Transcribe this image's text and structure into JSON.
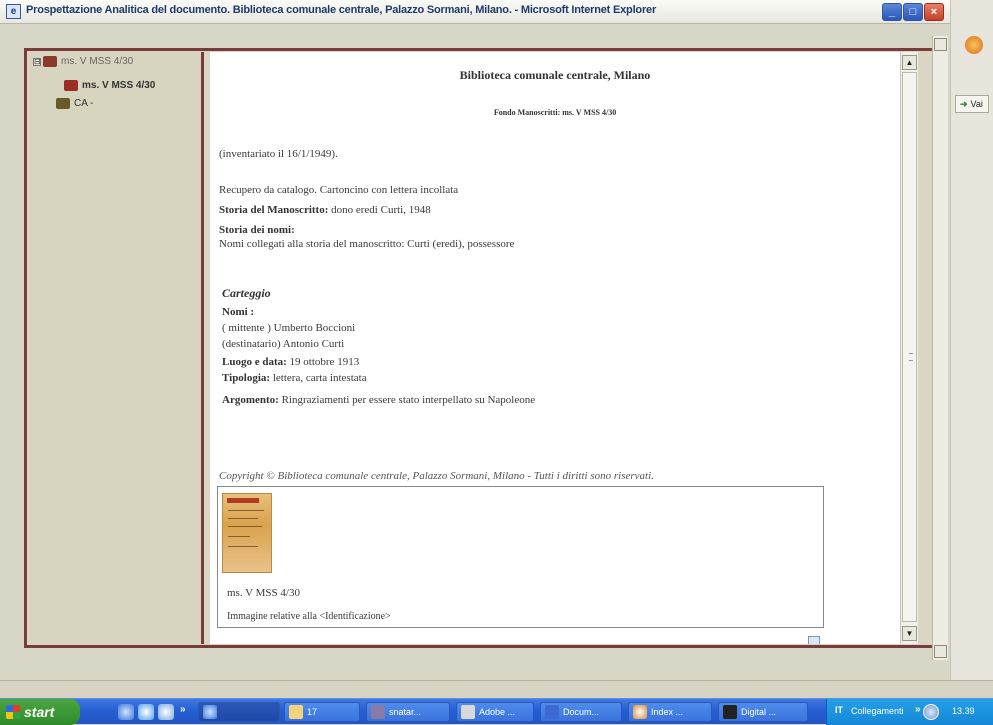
{
  "window": {
    "title": "Prospettazione Analitica del documento. Biblioteca comunale centrale, Palazzo Sormani, Milano. - Microsoft Internet Explorer",
    "min_label": "_",
    "max_label": "□",
    "close_label": "×"
  },
  "right_strip": {
    "vai_label": "Vai"
  },
  "tree": {
    "root_expander": "⊟",
    "root_label": "ms. V MSS 4/30",
    "child1_label": "ms. V MSS 4/30",
    "child2_label": "CA -"
  },
  "content": {
    "heading": "Biblioteca comunale centrale, Milano",
    "fondo": "Fondo Manoscritti: ms. V MSS 4/30",
    "inventariato": "(inventariato il 16/1/1949).",
    "recupero": "Recupero da catalogo. Cartoncino con lettera incollata",
    "storia_ms_label": "Storia del Manoscritto:",
    "storia_ms_value": " dono eredi Curti, 1948",
    "storia_nomi_label": "Storia dei nomi:",
    "nomi_collegati": "Nomi collegati alla storia del manoscritto: Curti (eredi), possessore",
    "carteggio": "Carteggio",
    "nomi_label": "Nomi :",
    "mittente": "( mittente ) Umberto Boccioni",
    "destinatario": "(destinatario) Antonio Curti",
    "luogo_label": "Luogo e data:",
    "luogo_value": " 19 ottobre 1913",
    "tipologia_label": "Tipologia:",
    "tipologia_value": " lettera, carta intestata",
    "argomento_label": "Argomento:",
    "argomento_value": " Ringraziamenti per essere stato interpellato su Napoleone",
    "copyright": "Copyright © Biblioteca comunale centrale, Palazzo Sormani, Milano - Tutti i diritti sono riservati.",
    "image_caption": "ms. V MSS 4/30",
    "image_desc": "Immagine relative alla <Identificazione>"
  },
  "taskbar": {
    "start_label": "start",
    "quicklaunch_chevron": "»",
    "buttons": [
      {
        "label": "",
        "active": true
      },
      {
        "label": "17",
        "active": false
      },
      {
        "label": "snatar...",
        "active": false
      },
      {
        "label": "Adobe ...",
        "active": false
      },
      {
        "label": "Docum...",
        "active": false
      },
      {
        "label": "Index ...",
        "active": false
      },
      {
        "label": "Digital ...",
        "active": false
      }
    ],
    "lang": "IT",
    "collegamenti": "Collegamenti",
    "tray_chevron": "»",
    "time": "13.39"
  }
}
